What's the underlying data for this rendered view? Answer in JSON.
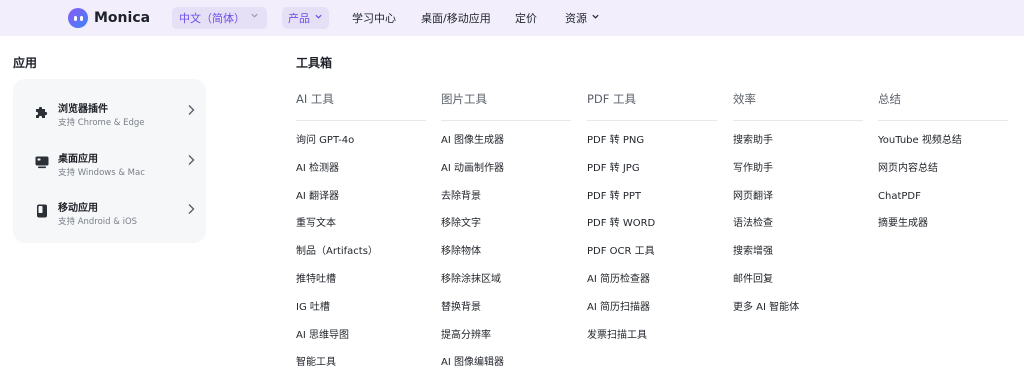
{
  "brand": {
    "name": "Monica"
  },
  "nav": {
    "language": "中文（简体）",
    "items": [
      {
        "label": "产品"
      },
      {
        "label": "学习中心"
      },
      {
        "label": "桌面/移动应用"
      },
      {
        "label": "定价"
      },
      {
        "label": "资源"
      }
    ]
  },
  "apps": {
    "title": "应用",
    "items": [
      {
        "title": "浏览器插件",
        "subtitle": "支持 Chrome & Edge",
        "icon": "puzzle-icon"
      },
      {
        "title": "桌面应用",
        "subtitle": "支持 Windows & Mac",
        "icon": "monitor-icon"
      },
      {
        "title": "移动应用",
        "subtitle": "支持 Android & iOS",
        "icon": "phone-icon"
      }
    ]
  },
  "toolbox": {
    "title": "工具箱",
    "columns": [
      {
        "heading": "AI 工具",
        "items": [
          "询问 GPT-4o",
          "AI 检测器",
          "AI 翻译器",
          "重写文本",
          "制品（Artifacts）",
          "推特吐槽",
          "IG 吐槽",
          "AI 思维导图",
          "智能工具"
        ]
      },
      {
        "heading": "图片工具",
        "items": [
          "AI 图像生成器",
          "AI 动画制作器",
          "去除背景",
          "移除文字",
          "移除物体",
          "移除涂抹区域",
          "替换背景",
          "提高分辨率",
          "AI 图像编辑器"
        ]
      },
      {
        "heading": "PDF 工具",
        "items": [
          "PDF 转 PNG",
          "PDF 转 JPG",
          "PDF 转 PPT",
          "PDF 转 WORD",
          "PDF OCR 工具",
          "AI 简历检查器",
          "AI 简历扫描器",
          "发票扫描工具"
        ]
      },
      {
        "heading": "效率",
        "items": [
          "搜索助手",
          "写作助手",
          "网页翻译",
          "语法检查",
          "搜索增强",
          "邮件回复",
          "更多 AI 智能体"
        ]
      },
      {
        "heading": "总结",
        "items": [
          "YouTube 视频总结",
          "网页内容总结",
          "ChatPDF",
          "摘要生成器"
        ]
      }
    ]
  }
}
